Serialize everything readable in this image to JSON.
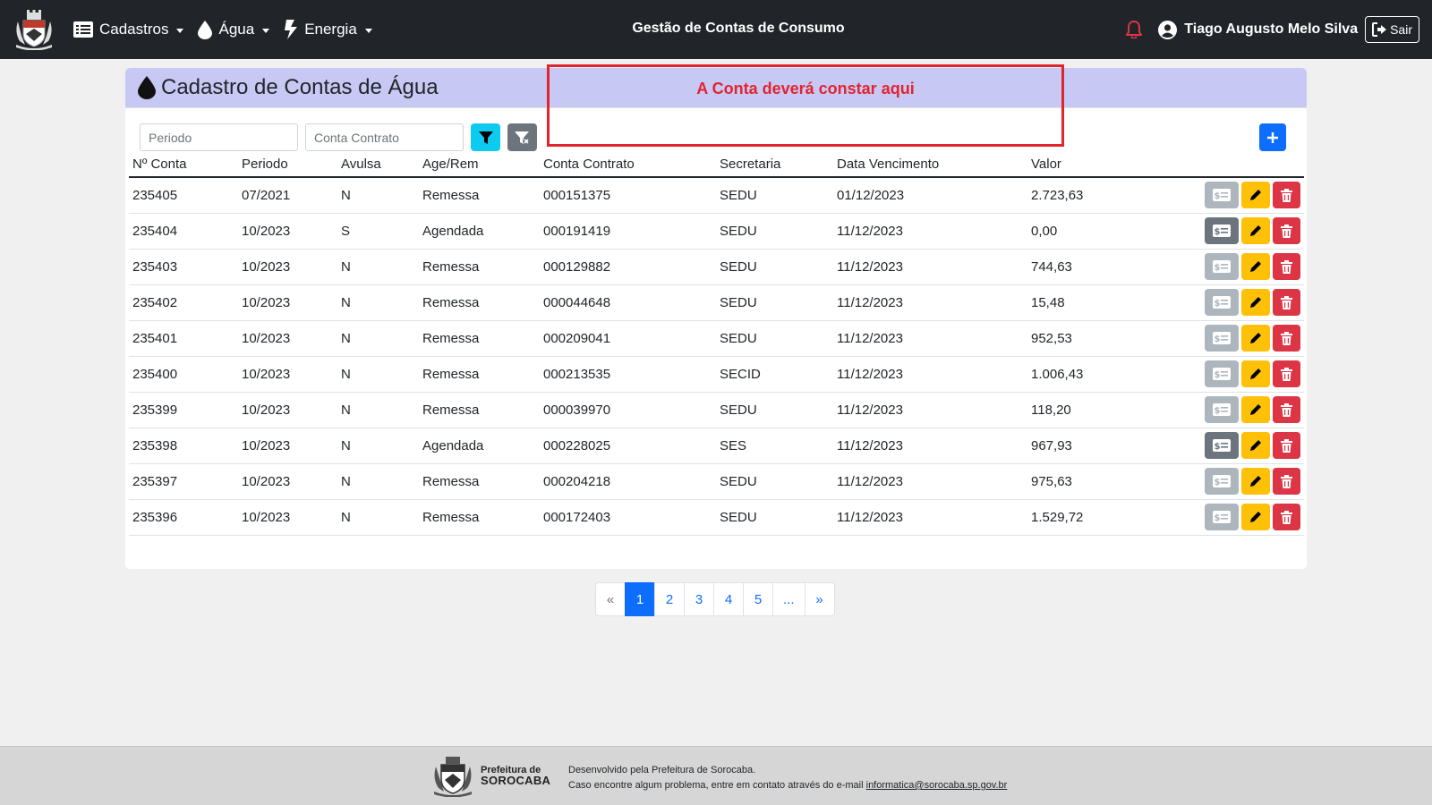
{
  "navbar": {
    "menus": [
      {
        "label": "Cadastros",
        "icon": "list-icon"
      },
      {
        "label": "Água",
        "icon": "water-drop-icon"
      },
      {
        "label": "Energia",
        "icon": "lightning-icon"
      }
    ],
    "title": "Gestão de Contas de Consumo",
    "user_name": "Tiago Augusto Melo Silva",
    "logout_label": "Sair"
  },
  "page": {
    "title": "Cadastro de Contas de Água",
    "filters": {
      "periodo_placeholder": "Periodo",
      "conta_placeholder": "Conta Contrato"
    }
  },
  "annotation": {
    "text": "A Conta deverá constar aqui",
    "color": "#e0252f"
  },
  "table": {
    "columns": [
      "Nº Conta",
      "Periodo",
      "Avulsa",
      "Age/Rem",
      "Conta Contrato",
      "Secretaria",
      "Data Vencimento",
      "Valor"
    ],
    "rows": [
      [
        "235405",
        "07/2021",
        "N",
        "Remessa",
        "000151375",
        "SEDU",
        "01/12/2023",
        "2.723,63"
      ],
      [
        "235404",
        "10/2023",
        "S",
        "Agendada",
        "000191419",
        "SEDU",
        "11/12/2023",
        "0,00"
      ],
      [
        "235403",
        "10/2023",
        "N",
        "Remessa",
        "000129882",
        "SEDU",
        "11/12/2023",
        "744,63"
      ],
      [
        "235402",
        "10/2023",
        "N",
        "Remessa",
        "000044648",
        "SEDU",
        "11/12/2023",
        "15,48"
      ],
      [
        "235401",
        "10/2023",
        "N",
        "Remessa",
        "000209041",
        "SEDU",
        "11/12/2023",
        "952,53"
      ],
      [
        "235400",
        "10/2023",
        "N",
        "Remessa",
        "000213535",
        "SECID",
        "11/12/2023",
        "1.006,43"
      ],
      [
        "235399",
        "10/2023",
        "N",
        "Remessa",
        "000039970",
        "SEDU",
        "11/12/2023",
        "118,20"
      ],
      [
        "235398",
        "10/2023",
        "N",
        "Agendada",
        "000228025",
        "SES",
        "11/12/2023",
        "967,93"
      ],
      [
        "235397",
        "10/2023",
        "N",
        "Remessa",
        "000204218",
        "SEDU",
        "11/12/2023",
        "975,63"
      ],
      [
        "235396",
        "10/2023",
        "N",
        "Remessa",
        "000172403",
        "SEDU",
        "11/12/2023",
        "1.529,72"
      ]
    ]
  },
  "pagination": {
    "items": [
      "«",
      "1",
      "2",
      "3",
      "4",
      "5",
      "...",
      "»"
    ],
    "active": "1"
  },
  "footer": {
    "logo_line1": "Prefeitura de",
    "logo_line2": "SOROCABA",
    "developed_by": "Desenvolvido pela Prefeitura de Sorocaba.",
    "contact_prefix": "Caso encontre algum problema, entre em contato através do e-mail ",
    "contact_email": "informatica@sorocaba.sp.gov.br"
  },
  "colors": {
    "navbar": "#212529",
    "header": "#c8c8f5",
    "primary": "#0d6efd",
    "info": "#0dcaf0",
    "warning": "#ffc107",
    "danger": "#dc3545",
    "secondary": "#6c757d"
  }
}
